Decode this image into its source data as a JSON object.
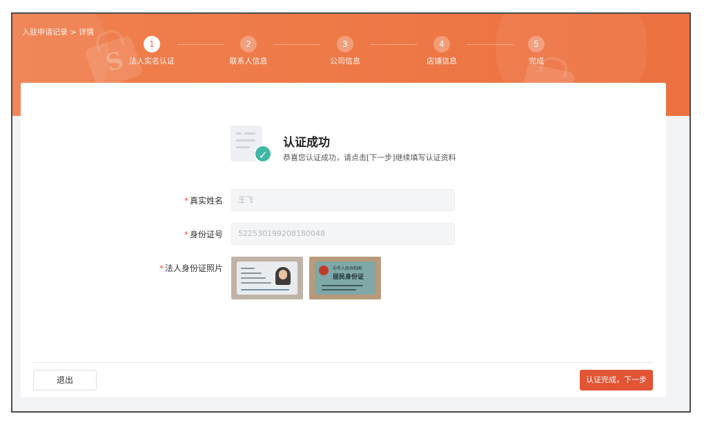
{
  "header": {
    "breadcrumb": "入驻申请记录 > 详情"
  },
  "steps": [
    {
      "num": "1",
      "label": "法人实名认证",
      "active": true
    },
    {
      "num": "2",
      "label": "联系人信息",
      "active": false
    },
    {
      "num": "3",
      "label": "公司信息",
      "active": false
    },
    {
      "num": "4",
      "label": "店铺信息",
      "active": false
    },
    {
      "num": "5",
      "label": "完成",
      "active": false
    }
  ],
  "success": {
    "title": "认证成功",
    "description": "恭喜您认证成功，请点击[下一步]继续填写认证资料"
  },
  "form": {
    "required_mark": "*",
    "name_label": "真实姓名",
    "name_value": "王飞",
    "id_label": "身份证号",
    "id_value": "522530199208180048",
    "photo_label": "法人身份证照片"
  },
  "photo_back": {
    "country_text": "中华人民共和国",
    "card_text": "居民身份证"
  },
  "footer": {
    "exit_label": "退出",
    "next_label": "认证完成，下一步"
  },
  "colors": {
    "banner": "#ee7a48",
    "primary_button": "#e15434",
    "success_check": "#3fb8a5",
    "required": "#e8502d"
  }
}
